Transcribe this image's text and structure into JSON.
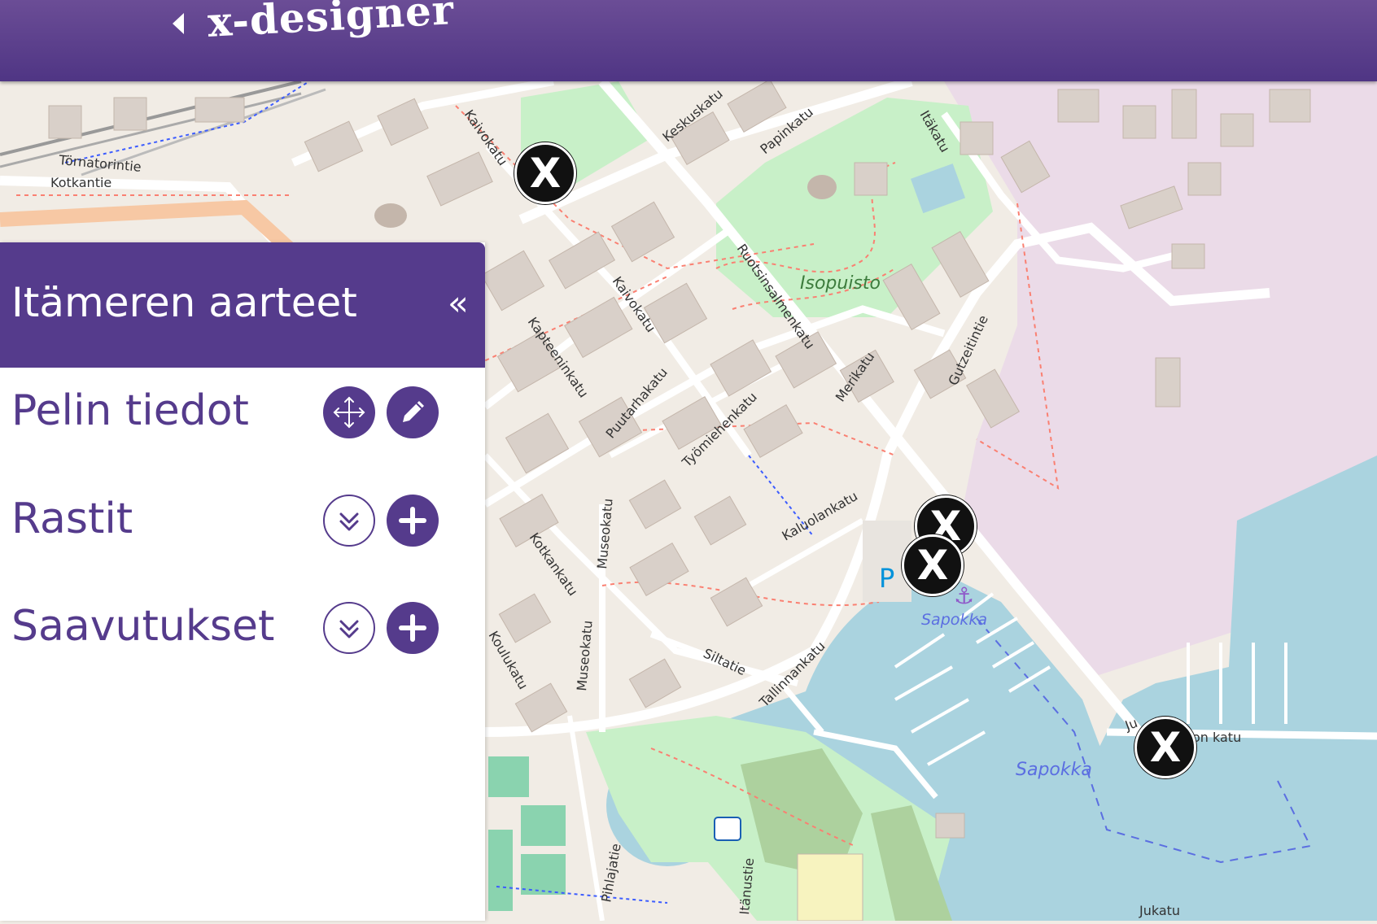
{
  "header": {
    "logo": "x-designer",
    "back_icon": "caret-left-icon",
    "background": "#553b8c"
  },
  "map": {
    "labels": [
      "Kaivokatu",
      "Keskuskatu",
      "Papinkatu",
      "Itäkatu",
      "Törnatorintie",
      "Kotkantie",
      "Isopuisto",
      "Ruotsinsalmenkatu",
      "Kaivokatu",
      "Kapteeninkatu",
      "Puutarhakatu",
      "Työmiehenkatu",
      "Merikatu",
      "Gutzeitintie",
      "Kotkankatu",
      "Museokatu",
      "Kaluolankatu",
      "Sapokka",
      "Sapokka",
      "Siltatie",
      "Tallinnankatu",
      "Museokatu",
      "Koulukatu",
      "Pihlajatie",
      "Itänustie",
      "Ju",
      "on katu",
      "Jukatu"
    ],
    "parking_label": "P",
    "markers": [
      "X",
      "X",
      "X",
      "X"
    ]
  },
  "panel": {
    "title": "Itämeren aarteet",
    "collapse_icon": "«",
    "rows": [
      {
        "label": "Pelin tiedot",
        "buttons": [
          "move-icon",
          "pencil-icon"
        ]
      },
      {
        "label": "Rastit",
        "buttons": [
          "double-chevron-down-icon",
          "plus-icon"
        ]
      },
      {
        "label": "Saavutukset",
        "buttons": [
          "double-chevron-down-icon",
          "plus-icon"
        ]
      }
    ]
  },
  "colors": {
    "accent": "#553b8c",
    "water": "#aad3df",
    "park": "#c8f0c8",
    "industrial": "#ebdbe8",
    "land": "#f1ece5",
    "building": "#d9d0c9"
  }
}
